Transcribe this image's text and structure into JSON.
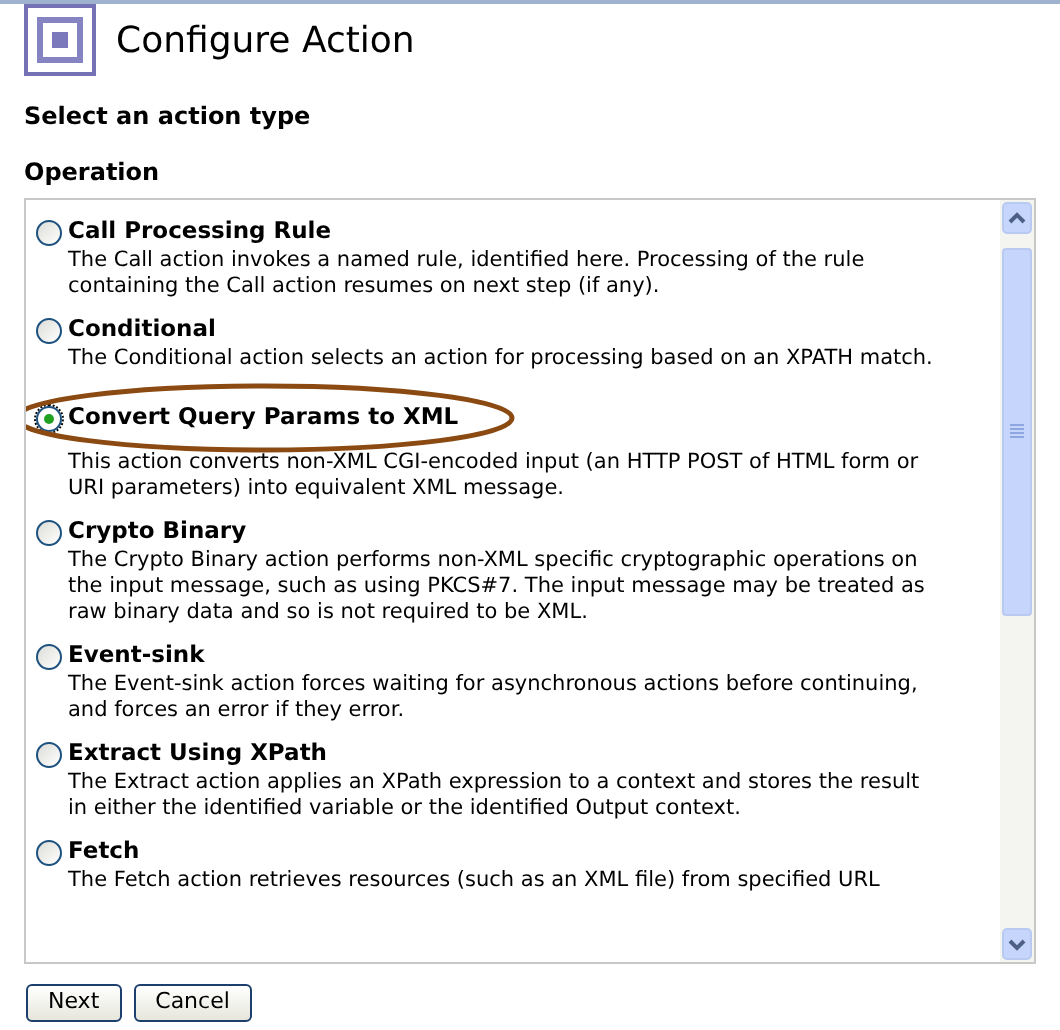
{
  "title": "Configure Action",
  "heading": "Select an action type",
  "section": "Operation",
  "options": [
    {
      "label": "Call Processing Rule",
      "description": "The Call action invokes a named rule, identified here. Processing of the rule containing the Call action resumes on next step (if any).",
      "selected": false
    },
    {
      "label": "Conditional",
      "description": "The Conditional action selects an action for processing based on an XPATH match.",
      "selected": false
    },
    {
      "label": "Convert Query Params to XML",
      "description": "This action converts non-XML CGI-encoded input (an HTTP POST of HTML form or URI parameters) into equivalent XML message.",
      "selected": true
    },
    {
      "label": "Crypto Binary",
      "description": "The Crypto Binary action performs non-XML specific cryptographic operations on the input message, such as using PKCS#7. The input message may be treated as raw binary data and so is not required to be XML.",
      "selected": false
    },
    {
      "label": "Event-sink",
      "description": "The Event-sink action forces waiting for asynchronous actions before continuing, and forces an error if they error.",
      "selected": false
    },
    {
      "label": "Extract Using XPath",
      "description": "The Extract action applies an XPath expression to a context and stores the result in either the identified variable or the identified Output context.",
      "selected": false
    },
    {
      "label": "Fetch",
      "description": "The Fetch action retrieves resources (such as an XML file) from specified URL",
      "selected": false
    }
  ],
  "buttons": [
    "Next",
    "Cancel"
  ]
}
